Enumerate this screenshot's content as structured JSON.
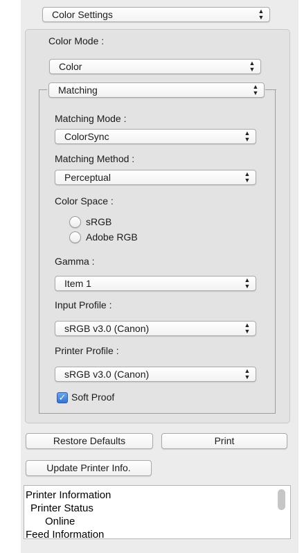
{
  "top_popup": {
    "value": "Color Settings"
  },
  "color_mode": {
    "label": "Color Mode :",
    "value": "Color"
  },
  "matching": {
    "popup_value": "Matching",
    "matching_mode": {
      "label": "Matching Mode :",
      "value": "ColorSync"
    },
    "matching_method": {
      "label": "Matching Method :",
      "value": "Perceptual"
    },
    "color_space": {
      "label": "Color Space :",
      "options": [
        {
          "label": "sRGB",
          "selected": false
        },
        {
          "label": "Adobe RGB",
          "selected": false
        }
      ]
    },
    "gamma": {
      "label": "Gamma :",
      "value": "Item 1"
    },
    "input_profile": {
      "label": "Input Profile :",
      "value": "sRGB v3.0 (Canon)"
    },
    "printer_profile": {
      "label": "Printer Profile :",
      "value": "sRGB v3.0 (Canon)"
    },
    "soft_proof": {
      "label": "Soft Proof",
      "checked": true
    }
  },
  "buttons": {
    "restore_defaults": "Restore Defaults",
    "print": "Print",
    "update_printer_info": "Update Printer Info."
  },
  "printer_info": {
    "lines": [
      "Printer Information",
      "Printer Status",
      "Online",
      "Feed Information"
    ]
  },
  "icons": {
    "popup_arrows": "updown-chevron-icon",
    "checkmark": "checkmark-icon",
    "radio": "radio-button-icon"
  }
}
